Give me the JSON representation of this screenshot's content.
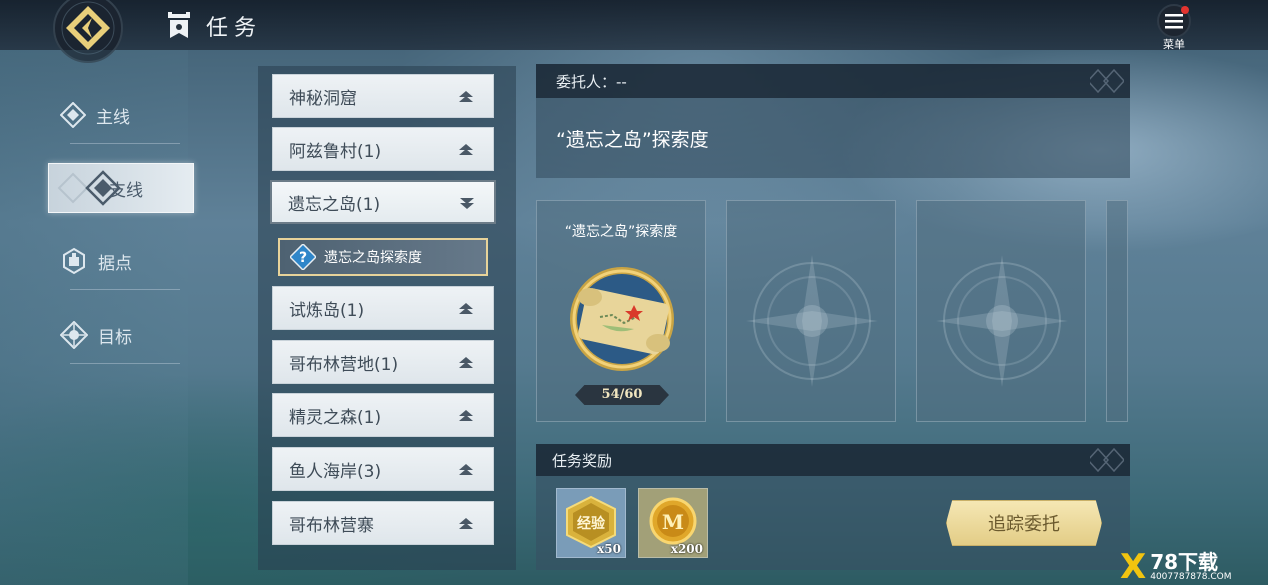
{
  "header": {
    "title": "任务",
    "menu_label": "菜单"
  },
  "nav": {
    "items": [
      {
        "label": "主线",
        "active": false
      },
      {
        "label": "支线",
        "active": true
      },
      {
        "label": "据点",
        "active": false
      },
      {
        "label": "目标",
        "active": false
      }
    ]
  },
  "quest_list": [
    {
      "label": "神秘洞窟",
      "expanded": false
    },
    {
      "label": "阿兹鲁村(1)",
      "expanded": false
    },
    {
      "label": "遗忘之岛(1)",
      "expanded": true
    },
    {
      "label": "试炼岛(1)",
      "expanded": false
    },
    {
      "label": "哥布林营地(1)",
      "expanded": false
    },
    {
      "label": "精灵之森(1)",
      "expanded": false
    },
    {
      "label": "鱼人海岸(3)",
      "expanded": false
    },
    {
      "label": "哥布林营寨",
      "expanded": false
    }
  ],
  "selected_quest": {
    "label": "遗忘之岛探索度"
  },
  "detail": {
    "client_label": "委托人：--",
    "description": "“遗忘之岛”探索度",
    "cards": [
      {
        "title": "“遗忘之岛”探索度",
        "progress": "54/60",
        "icon": "map-scroll-icon"
      },
      {
        "title": "",
        "icon": "locked-emblem-icon"
      },
      {
        "title": "",
        "icon": "locked-emblem-icon"
      }
    ],
    "rewards_title": "任务奖励",
    "rewards": [
      {
        "icon": "exp-badge-icon",
        "badge_text": "经验",
        "qty": "x50"
      },
      {
        "icon": "gold-coin-icon",
        "badge_text": "M",
        "qty": "x200"
      }
    ],
    "track_button": "追踪委托"
  },
  "watermark": {
    "mark": "X",
    "main": "78下载",
    "sub": "4007787878.COM"
  },
  "colors": {
    "gold_button": "#e9d492",
    "panel_dark": "#1a2836",
    "accent_yellow": "#e7d39a"
  }
}
